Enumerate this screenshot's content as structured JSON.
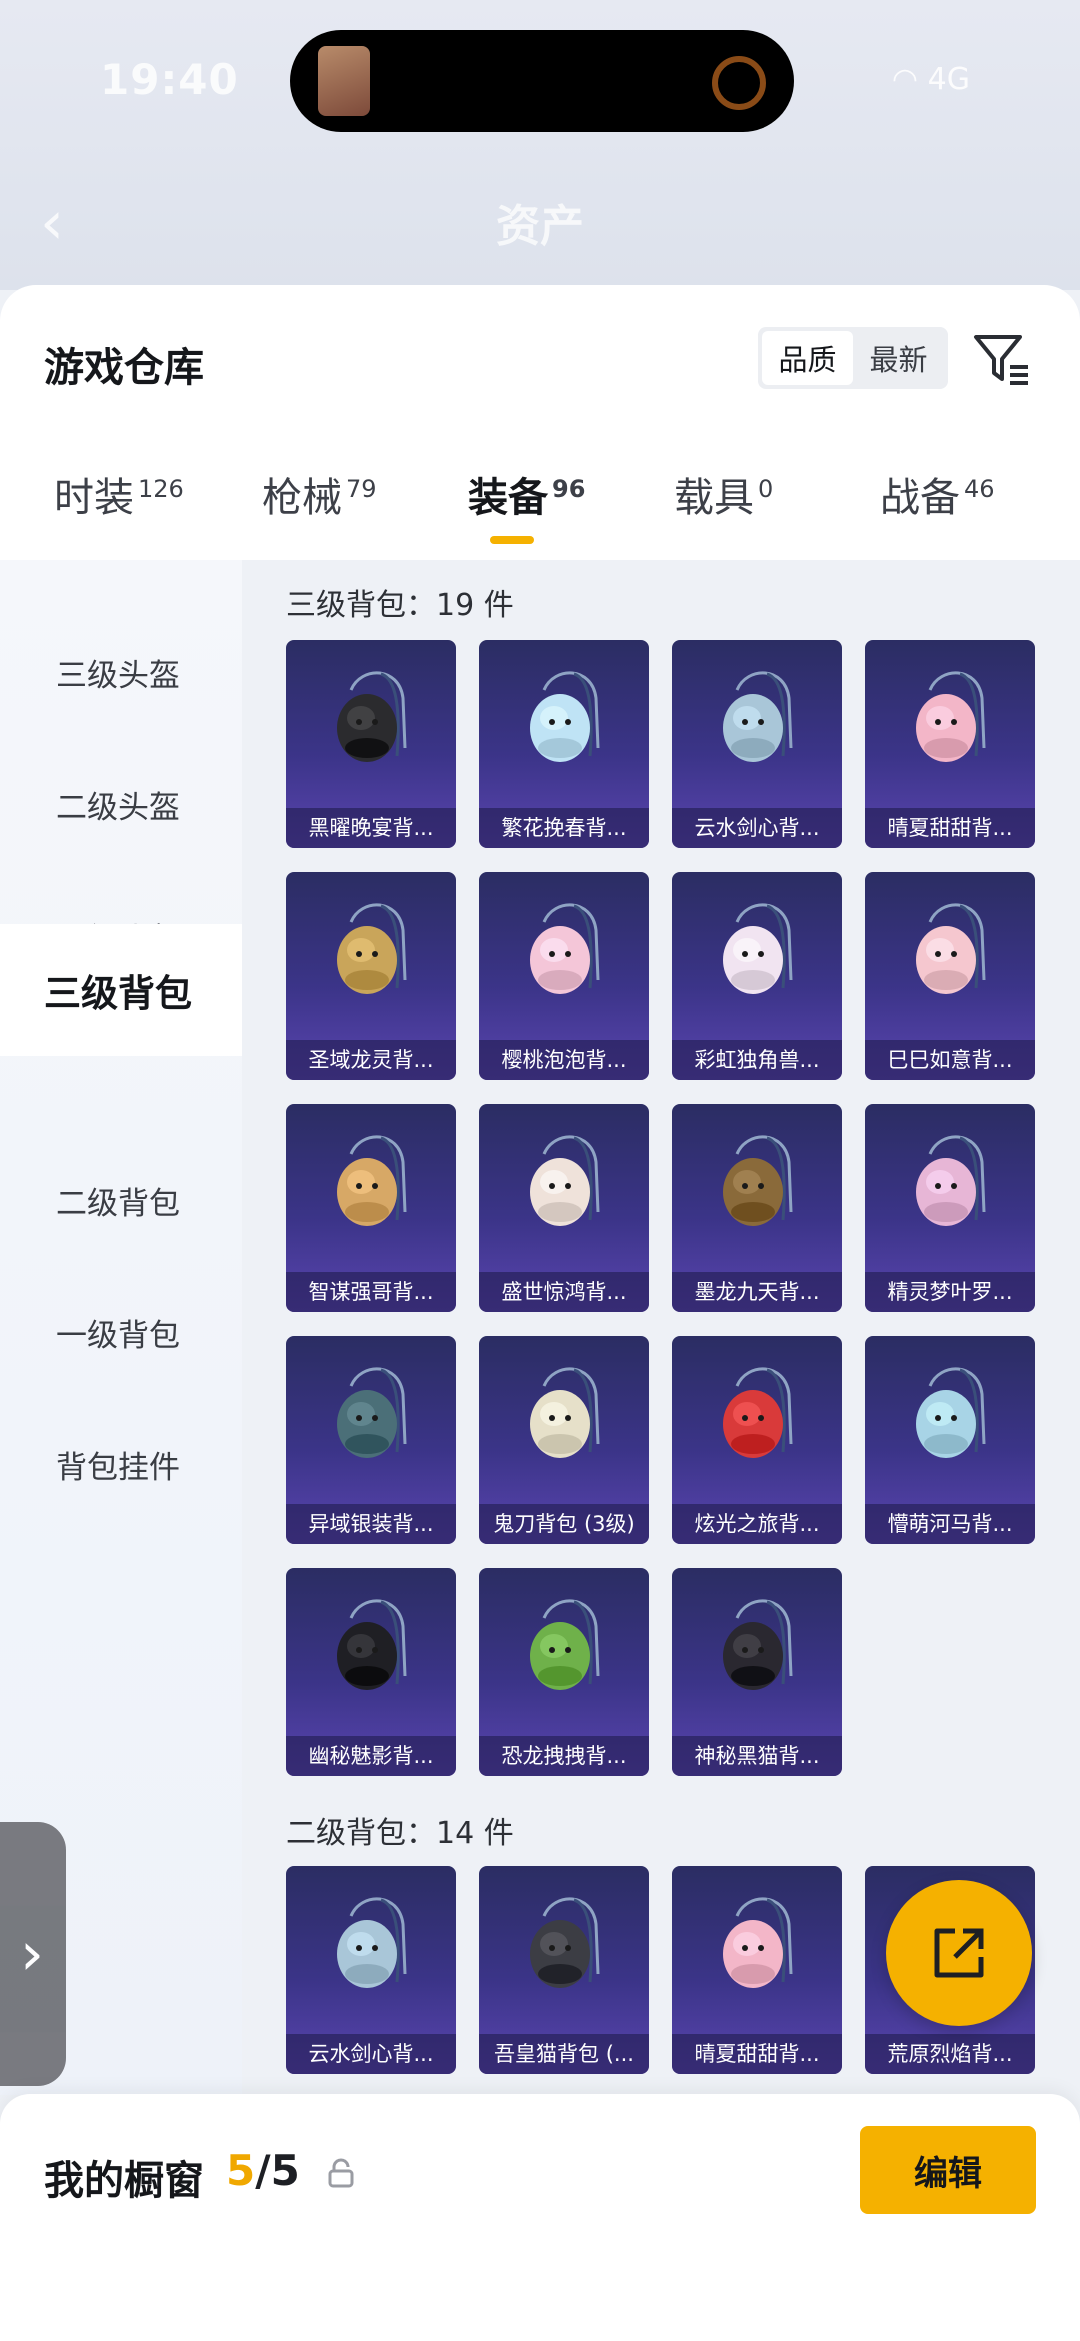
{
  "status_bar": {
    "time": "19:40",
    "network": "4G"
  },
  "page": {
    "title": "资产"
  },
  "header": {
    "title": "游戏仓库",
    "sort_options": [
      "品质",
      "最新"
    ],
    "active_sort": "品质"
  },
  "tabs": [
    {
      "label": "时装",
      "count": "126"
    },
    {
      "label": "枪械",
      "count": "79"
    },
    {
      "label": "装备",
      "count": "96",
      "active": true
    },
    {
      "label": "载具",
      "count": "0"
    },
    {
      "label": "战备",
      "count": "46"
    }
  ],
  "sidebar": {
    "items": [
      "三级头盔",
      "二级头盔",
      "一级头盔",
      "三级背包",
      "二级背包",
      "一级背包",
      "背包挂件"
    ],
    "active": "三级背包"
  },
  "sections": [
    {
      "label": "三级背包：19 件",
      "items": [
        {
          "name": "黑曜晚宴背...",
          "icon": "black-dog-backpack-icon",
          "color": "#2b2b2e"
        },
        {
          "name": "繁花挽春背...",
          "icon": "floral-backpack-icon",
          "color": "#bfe3f5"
        },
        {
          "name": "云水剑心背...",
          "icon": "sword-backpack-icon",
          "color": "#a9c6d8"
        },
        {
          "name": "晴夏甜甜背...",
          "icon": "pink-bunny-backpack-icon",
          "color": "#f3b6c8"
        },
        {
          "name": "圣域龙灵背...",
          "icon": "golden-dragon-backpack-icon",
          "color": "#c9a55a"
        },
        {
          "name": "樱桃泡泡背...",
          "icon": "pink-bow-backpack-icon",
          "color": "#f4c6d8"
        },
        {
          "name": "彩虹独角兽...",
          "icon": "unicorn-backpack-icon",
          "color": "#f1e4f1"
        },
        {
          "name": "巳巳如意背...",
          "icon": "pink-snake-backpack-icon",
          "color": "#f5c7cf"
        },
        {
          "name": "智谋强哥背...",
          "icon": "plush-dog-backpack-icon",
          "color": "#d7a866"
        },
        {
          "name": "盛世惊鸿背...",
          "icon": "feather-backpack-icon",
          "color": "#efe2da"
        },
        {
          "name": "墨龙九天背...",
          "icon": "dark-dragon-backpack-icon",
          "color": "#8a6a3a"
        },
        {
          "name": "精灵梦叶罗...",
          "icon": "heart-wing-backpack-icon",
          "color": "#e7b6d6"
        },
        {
          "name": "异域银装背...",
          "icon": "tactical-backpack-icon",
          "color": "#4b6f78"
        },
        {
          "name": "鬼刀背包 (3级)",
          "icon": "crystal-backpack-icon",
          "color": "#e6e0c9"
        },
        {
          "name": "炫光之旅背...",
          "icon": "red-monster-backpack-icon",
          "color": "#d93a3a"
        },
        {
          "name": "懵萌河马背...",
          "icon": "hippo-backpack-icon",
          "color": "#a8d4e6"
        },
        {
          "name": "幽秘魅影背...",
          "icon": "black-lace-backpack-icon",
          "color": "#1f1f24"
        },
        {
          "name": "恐龙拽拽背...",
          "icon": "green-dino-backpack-icon",
          "color": "#6fb14a"
        },
        {
          "name": "神秘黑猫背...",
          "icon": "black-cat-backpack-icon",
          "color": "#2a2830"
        }
      ]
    },
    {
      "label": "二级背包：14 件",
      "items": [
        {
          "name": "云水剑心背...",
          "icon": "sword-backpack-icon",
          "color": "#a9c6d8"
        },
        {
          "name": "吾皇猫背包 (...",
          "icon": "gray-cat-backpack-icon",
          "color": "#3c3d44"
        },
        {
          "name": "晴夏甜甜背...",
          "icon": "pink-bunny-backpack-icon",
          "color": "#f3b6c8"
        },
        {
          "name": "荒原烈焰背...",
          "icon": "flame-backpack-icon",
          "color": "#d8572a"
        }
      ]
    }
  ],
  "bottom_bar": {
    "label": "我的橱窗",
    "current": "5",
    "total": "/5",
    "edit_label": "编辑"
  },
  "colors": {
    "accent": "#f5b100",
    "card_top": "#2b2d63",
    "card_bottom": "#5a45b0"
  }
}
